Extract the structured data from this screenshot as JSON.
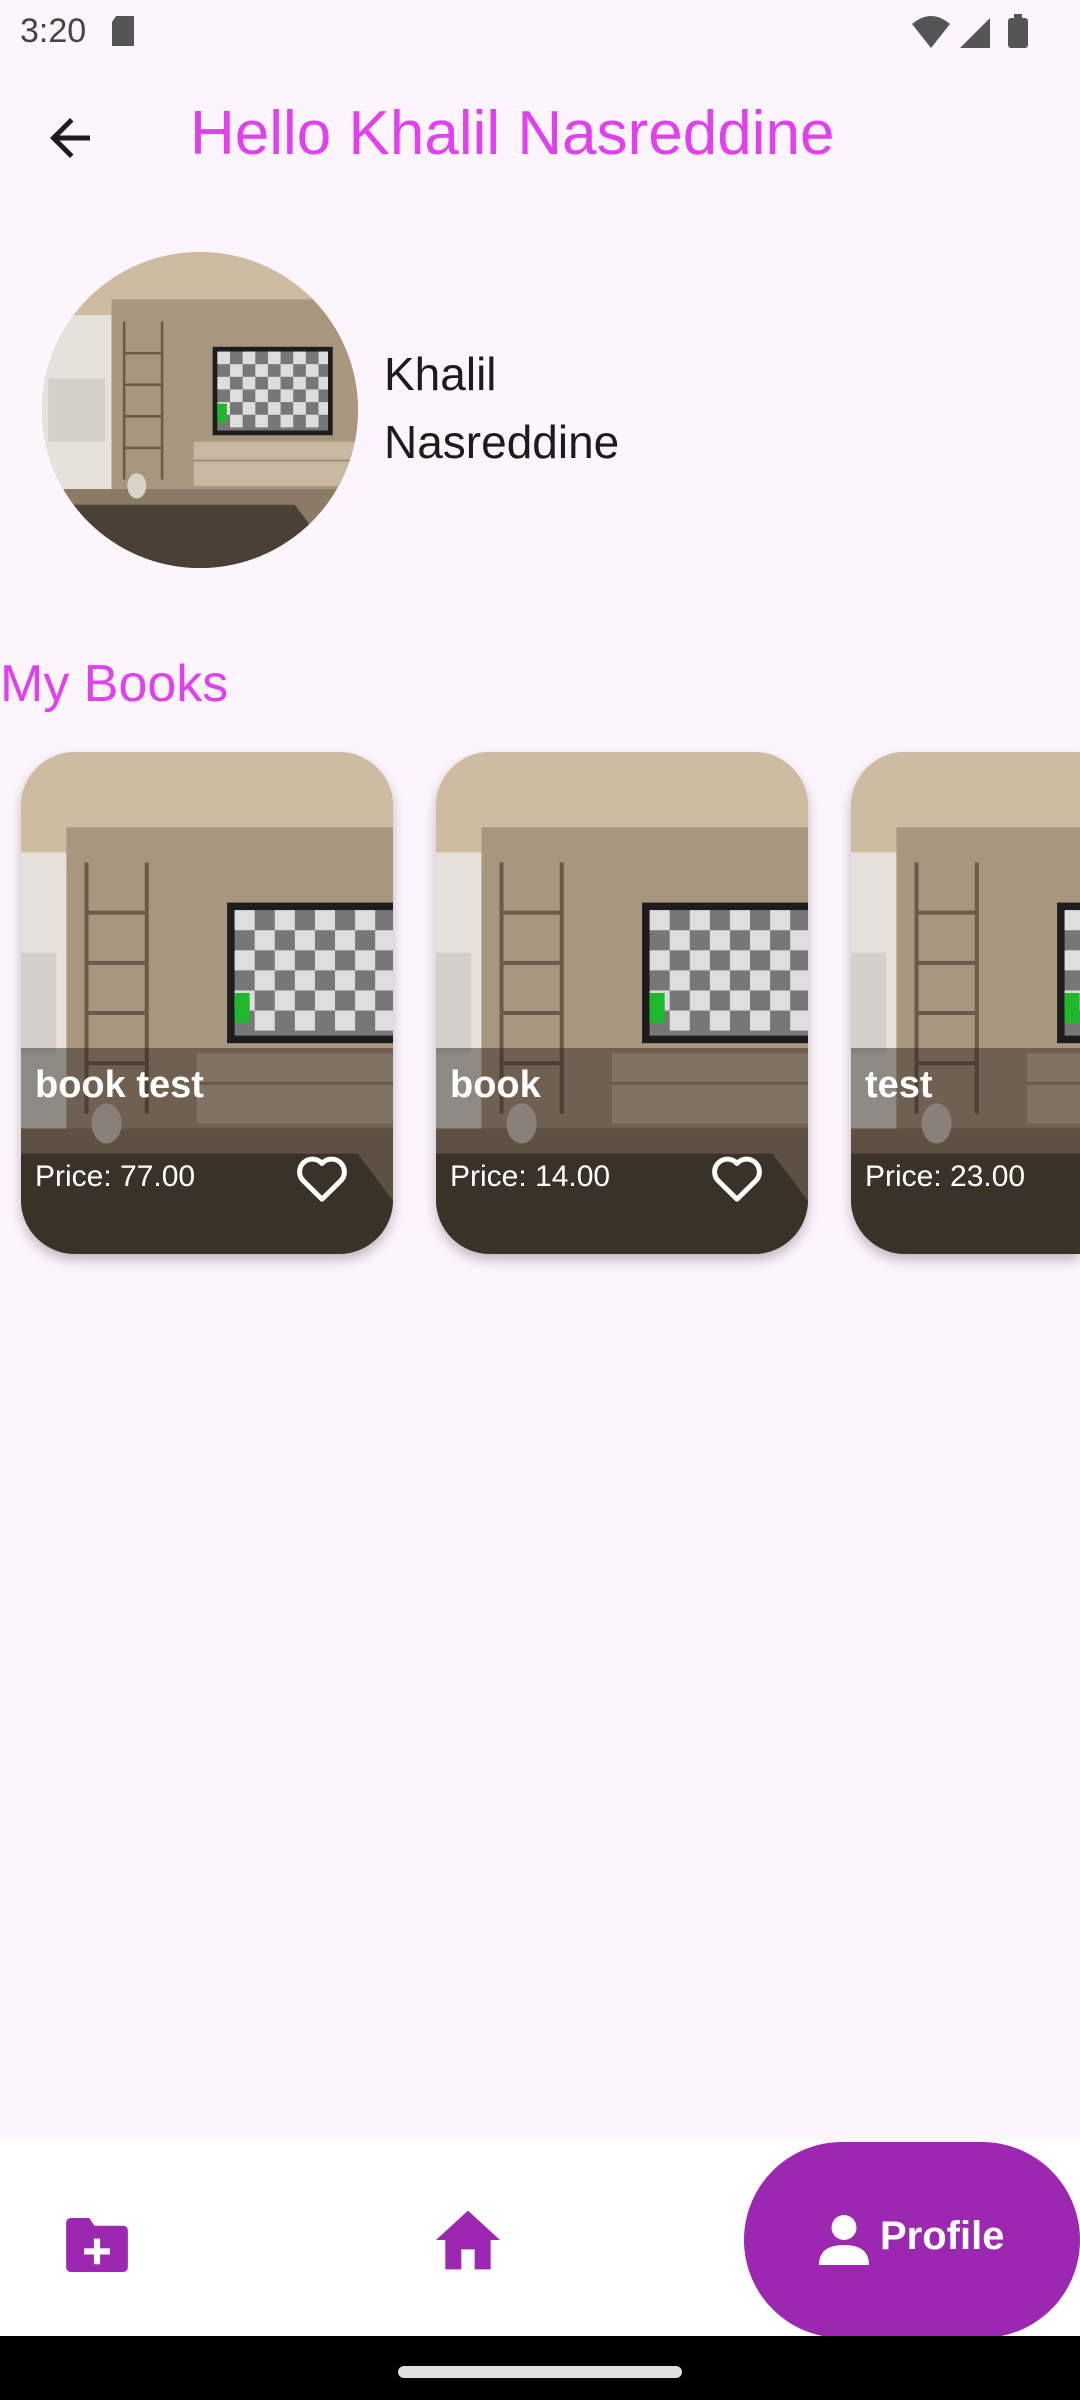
{
  "status_bar": {
    "time": "3:20"
  },
  "app_bar": {
    "title": "Hello Khalil Nasreddine"
  },
  "profile": {
    "first_name": "Khalil",
    "last_name": "Nasreddine"
  },
  "section": {
    "title": "My Books"
  },
  "books": [
    {
      "title": "book test",
      "price": "Price: 77.00"
    },
    {
      "title": "book",
      "price": "Price: 14.00"
    },
    {
      "title": "test",
      "price": "Price: 23.00"
    }
  ],
  "bottom_nav": {
    "items": [
      {
        "icon": "folder-add-icon"
      },
      {
        "icon": "home-icon"
      },
      {
        "icon": "person-icon",
        "label": "Profile",
        "selected": true
      }
    ]
  },
  "colors": {
    "accent": "#e040ee",
    "nav_selected": "#9c27b0",
    "background": "#fdf5fc"
  }
}
